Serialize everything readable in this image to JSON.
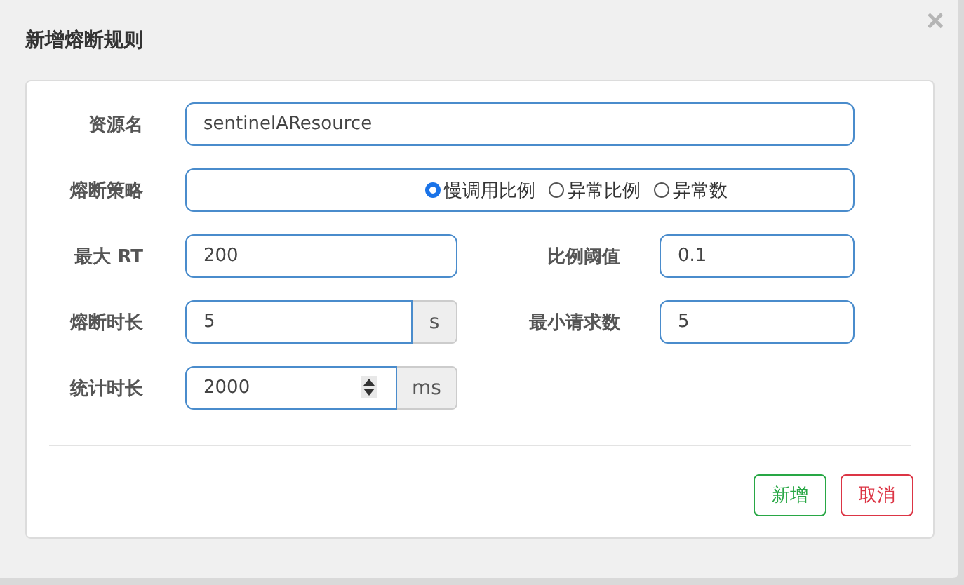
{
  "dialog": {
    "title": "新增熔断规则",
    "close": "×"
  },
  "resource": {
    "label": "资源名",
    "value": "sentinelAResource"
  },
  "strategy": {
    "label": "熔断策略",
    "options": [
      {
        "label": "慢调用比例",
        "selected": true
      },
      {
        "label": "异常比例",
        "selected": false
      },
      {
        "label": "异常数",
        "selected": false
      }
    ]
  },
  "fields": [
    {
      "label": "最大 RT",
      "value": "200",
      "kind": "text"
    },
    {
      "label": "比例阈值",
      "value": "0.1",
      "kind": "text"
    },
    {
      "label": "熔断时长",
      "value": "5",
      "kind": "text",
      "unit": "s"
    },
    {
      "label": "最小请求数",
      "value": "5",
      "kind": "text"
    },
    {
      "label": "统计时长",
      "value": "2000",
      "kind": "number",
      "unit": "ms"
    }
  ],
  "buttons": [
    {
      "label": "新增",
      "kind": "primary"
    },
    {
      "label": "取消",
      "kind": "cancel"
    }
  ]
}
